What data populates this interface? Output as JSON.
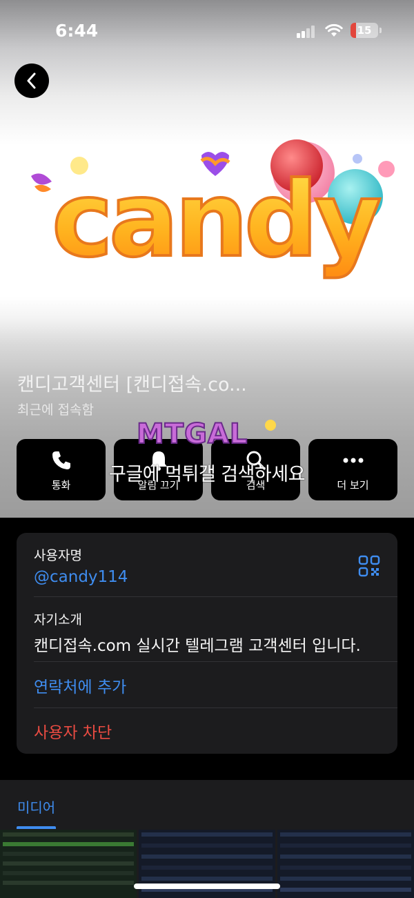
{
  "status_bar": {
    "time": "6:44",
    "battery": "15",
    "battery_color": "#e2463c"
  },
  "header": {
    "back_icon": "chevron-left-icon",
    "logo_text": "candy",
    "name": "캔디고객센터 [캔디접속.co...",
    "status": "최근에 접속함"
  },
  "actions": [
    {
      "label": "통화",
      "icon": "phone-icon"
    },
    {
      "label": "알림 끄기",
      "icon": "bell-icon"
    },
    {
      "label": "검색",
      "icon": "search-icon"
    },
    {
      "label": "더 보기",
      "icon": "more-icon"
    }
  ],
  "watermark": {
    "logo_text": "MTGAL",
    "caption": "구글에 먹튀갤 검색하세요"
  },
  "info": {
    "username_label": "사용자명",
    "username": "@candy114",
    "bio_label": "자기소개",
    "bio": "캔디접속.com 실시간 텔레그램 고객센터 입니다.",
    "add_contact": "연락처에 추가",
    "block_user": "사용자 차단"
  },
  "media": {
    "tab_label": "미디어"
  },
  "colors": {
    "accent": "#3f8df0",
    "danger": "#ea4b42",
    "card_bg": "#1c1c1e"
  }
}
